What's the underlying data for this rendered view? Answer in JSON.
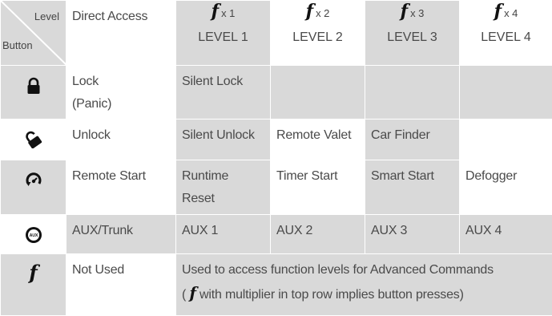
{
  "header": {
    "corner_level": "Level",
    "corner_button": "Button",
    "direct_access": "Direct Access",
    "fx_symbol": "f",
    "levels": [
      {
        "mult": "x 1",
        "label": "LEVEL 1"
      },
      {
        "mult": "x 2",
        "label": "LEVEL 2"
      },
      {
        "mult": "x 3",
        "label": "LEVEL 3"
      },
      {
        "mult": "x 4",
        "label": "LEVEL 4"
      }
    ]
  },
  "rows": {
    "lock": {
      "icon": "lock-icon",
      "direct_line1": "Lock",
      "direct_line2": "(Panic)",
      "l1": "Silent Lock",
      "l2": "",
      "l3": "",
      "l4": ""
    },
    "unlock": {
      "icon": "unlock-icon",
      "direct": "Unlock",
      "l1": "Silent Unlock",
      "l2": "Remote Valet",
      "l3": "Car Finder",
      "l4": ""
    },
    "start": {
      "icon": "remote-start-icon",
      "direct": "Remote Start",
      "l1_line1": "Runtime",
      "l1_line2": "Reset",
      "l2": "Timer Start",
      "l3": "Smart Start",
      "l4": "Defogger"
    },
    "aux": {
      "icon": "aux-icon",
      "icon_text": "AUX",
      "direct": "AUX/Trunk",
      "l1": "AUX 1",
      "l2": "AUX 2",
      "l3": "AUX 3",
      "l4": "AUX 4"
    },
    "function": {
      "icon": "function-f-icon",
      "icon_text": "f",
      "direct": "Not Used",
      "span_line1": "Used to access function levels for Advanced Commands",
      "span_line2_pre": "(",
      "span_line2_post": "with multiplier in top row implies button presses)"
    }
  },
  "colors": {
    "gray": "#d9d9d9",
    "white": "#ffffff",
    "text": "#4a4a4a",
    "icon": "#111111"
  }
}
